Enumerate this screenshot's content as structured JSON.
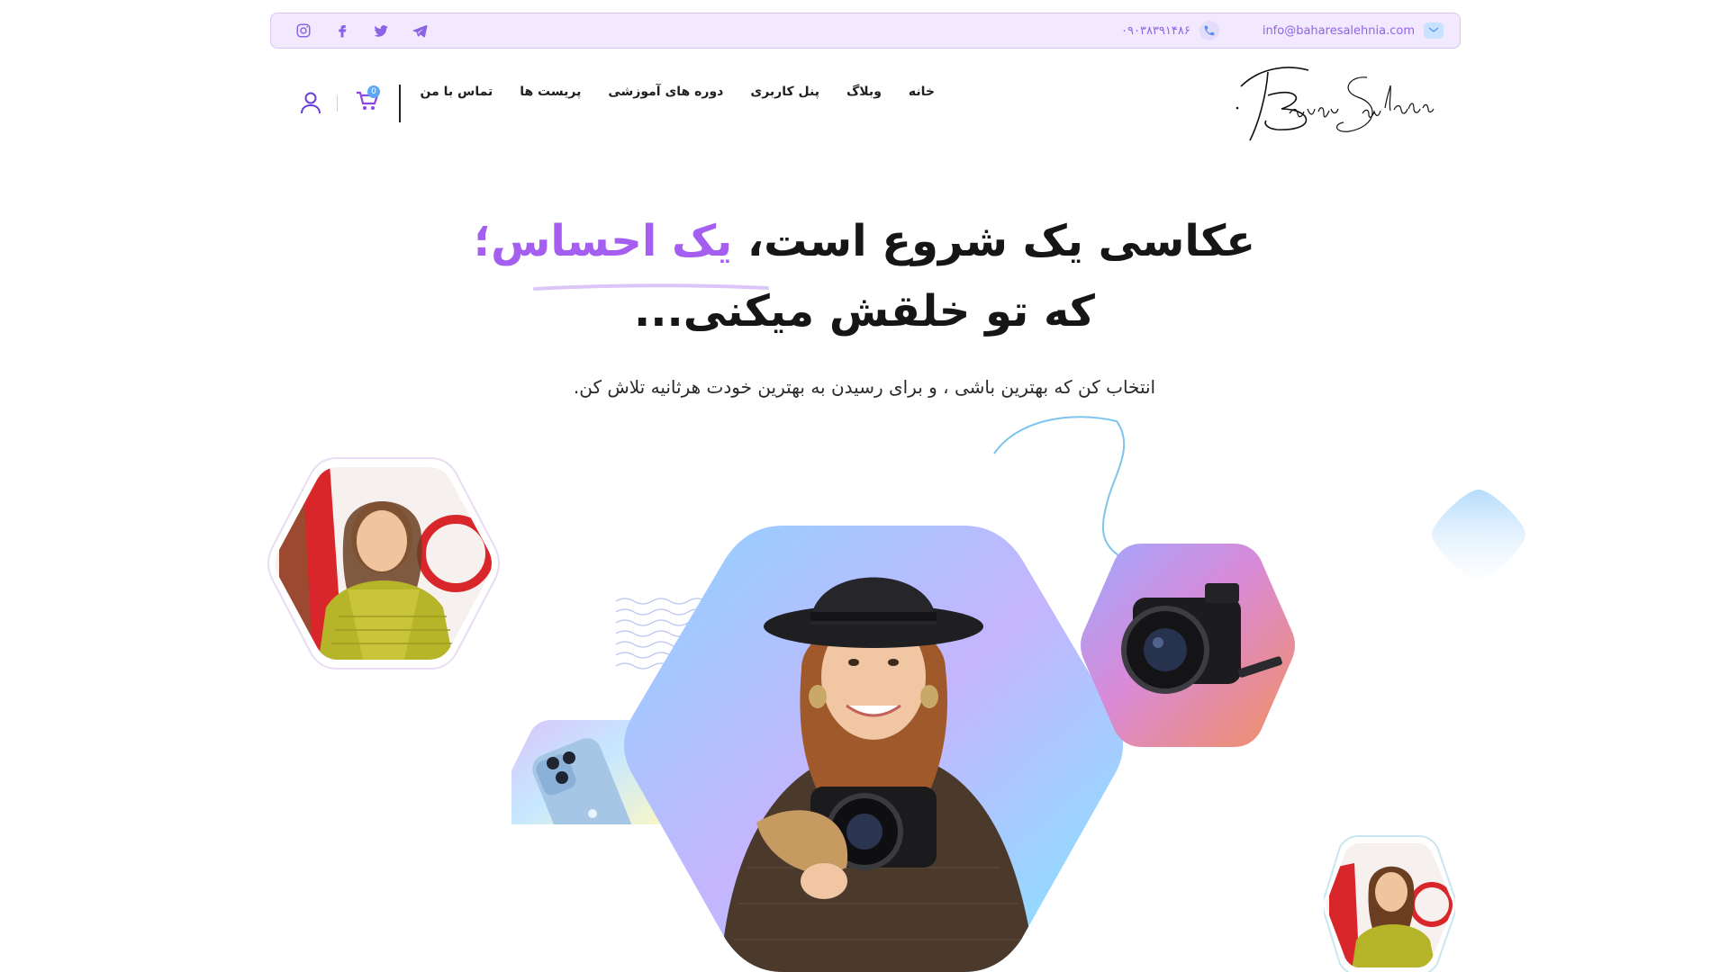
{
  "topbar": {
    "email": "info@baharesalehnia.com",
    "phone": "۰۹۰۳۸۳۹۱۴۸۶",
    "social": [
      "instagram-icon",
      "facebook-icon",
      "twitter-icon",
      "telegram-icon"
    ]
  },
  "nav": {
    "items": [
      "خانه",
      "وبلاگ",
      "پنل کاربری",
      "دوره های آموزشی",
      "پریست ها",
      "تماس با من"
    ]
  },
  "cart": {
    "count": "0"
  },
  "hero": {
    "line1_main": "عکاسی یک شروع است، ",
    "line1_accent": "یک احساس؛",
    "line2": "که تو خلقش میکنی...",
    "subtitle": "انتخاب کن که بهترین باشی ، و برای رسیدن به بهترین خودت هرثانیه تلاش کن."
  },
  "colors": {
    "accent": "#a45ef0",
    "topbar_bg": "#f2e9ff",
    "topbar_border": "#d8c7f2",
    "link": "#8f63e8",
    "blue": "#5ca8f5"
  }
}
